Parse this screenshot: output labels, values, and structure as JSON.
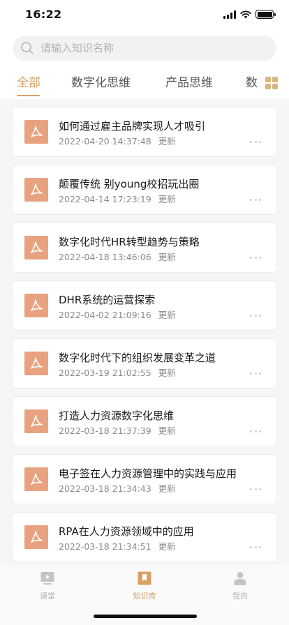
{
  "status_bar": {
    "time": "16:22"
  },
  "search": {
    "placeholder": "请输入知识名称"
  },
  "tabs": [
    {
      "label": "全部",
      "active": true
    },
    {
      "label": "数字化思维",
      "active": false
    },
    {
      "label": "产品思维",
      "active": false
    },
    {
      "label": "数",
      "active": false
    }
  ],
  "items": [
    {
      "title": "如何通过雇主品牌实现人才吸引",
      "date": "2022-04-20 14:37:48",
      "tag": "更新",
      "icon": "pdf-icon"
    },
    {
      "title": "颠覆传统 别young校招玩出圈",
      "date": "2022-04-14 17:23:19",
      "tag": "更新",
      "icon": "pdf-icon"
    },
    {
      "title": "数字化时代HR转型趋势与策略",
      "date": "2022-04-18 13:46:06",
      "tag": "更新",
      "icon": "pdf-icon"
    },
    {
      "title": "DHR系统的运营探索",
      "date": "2022-04-02 21:09:16",
      "tag": "更新",
      "icon": "pdf-icon"
    },
    {
      "title": "数字化时代下的组织发展变革之道",
      "date": "2022-03-19 21:02:55",
      "tag": "更新",
      "icon": "pdf-icon"
    },
    {
      "title": "打造人力资源数字化思维",
      "date": "2022-03-18 21:37:39",
      "tag": "更新",
      "icon": "pdf-icon"
    },
    {
      "title": "电子签在人力资源管理中的实践与应用",
      "date": "2022-03-18 21:34:43",
      "tag": "更新",
      "icon": "pdf-icon"
    },
    {
      "title": "RPA在人力资源领域中的应用",
      "date": "2022-03-18 21:34:51",
      "tag": "更新",
      "icon": "pdf-icon"
    }
  ],
  "tabbar": [
    {
      "label": "课堂",
      "icon": "play-icon",
      "active": false
    },
    {
      "label": "知识库",
      "icon": "bookmark-icon",
      "active": true
    },
    {
      "label": "我的",
      "icon": "person-icon",
      "active": false
    }
  ],
  "colors": {
    "accent": "#d9a064",
    "pdf": "#e9a27f",
    "list_bg": "#f6f6f6"
  }
}
